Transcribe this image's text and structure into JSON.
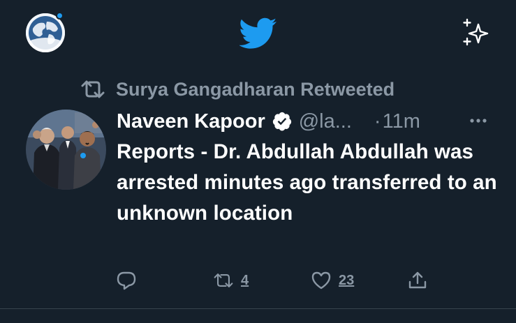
{
  "colors": {
    "background": "#15202b",
    "accent": "#1d9bf0",
    "muted": "#8b98a5",
    "text": "#ffffff",
    "divider": "#38444d"
  },
  "header": {
    "profile_avatar_icon": "globe-avatar",
    "logo_icon": "twitter-bird-icon",
    "top_tweets_icon": "sparkle-icon"
  },
  "retweet_context": {
    "icon": "retweet-icon",
    "label": "Surya Gangadharan Retweeted"
  },
  "tweet": {
    "author_name": "Naveen Kapoor",
    "verified": true,
    "handle": "@la...",
    "separator": "·",
    "time": "11m",
    "text": "Reports - Dr. Abdullah Abdullah was arrested minutes ago transferred to an unknown location",
    "actions": {
      "reply_count": "",
      "retweet_count": "4",
      "like_count": "23"
    }
  }
}
